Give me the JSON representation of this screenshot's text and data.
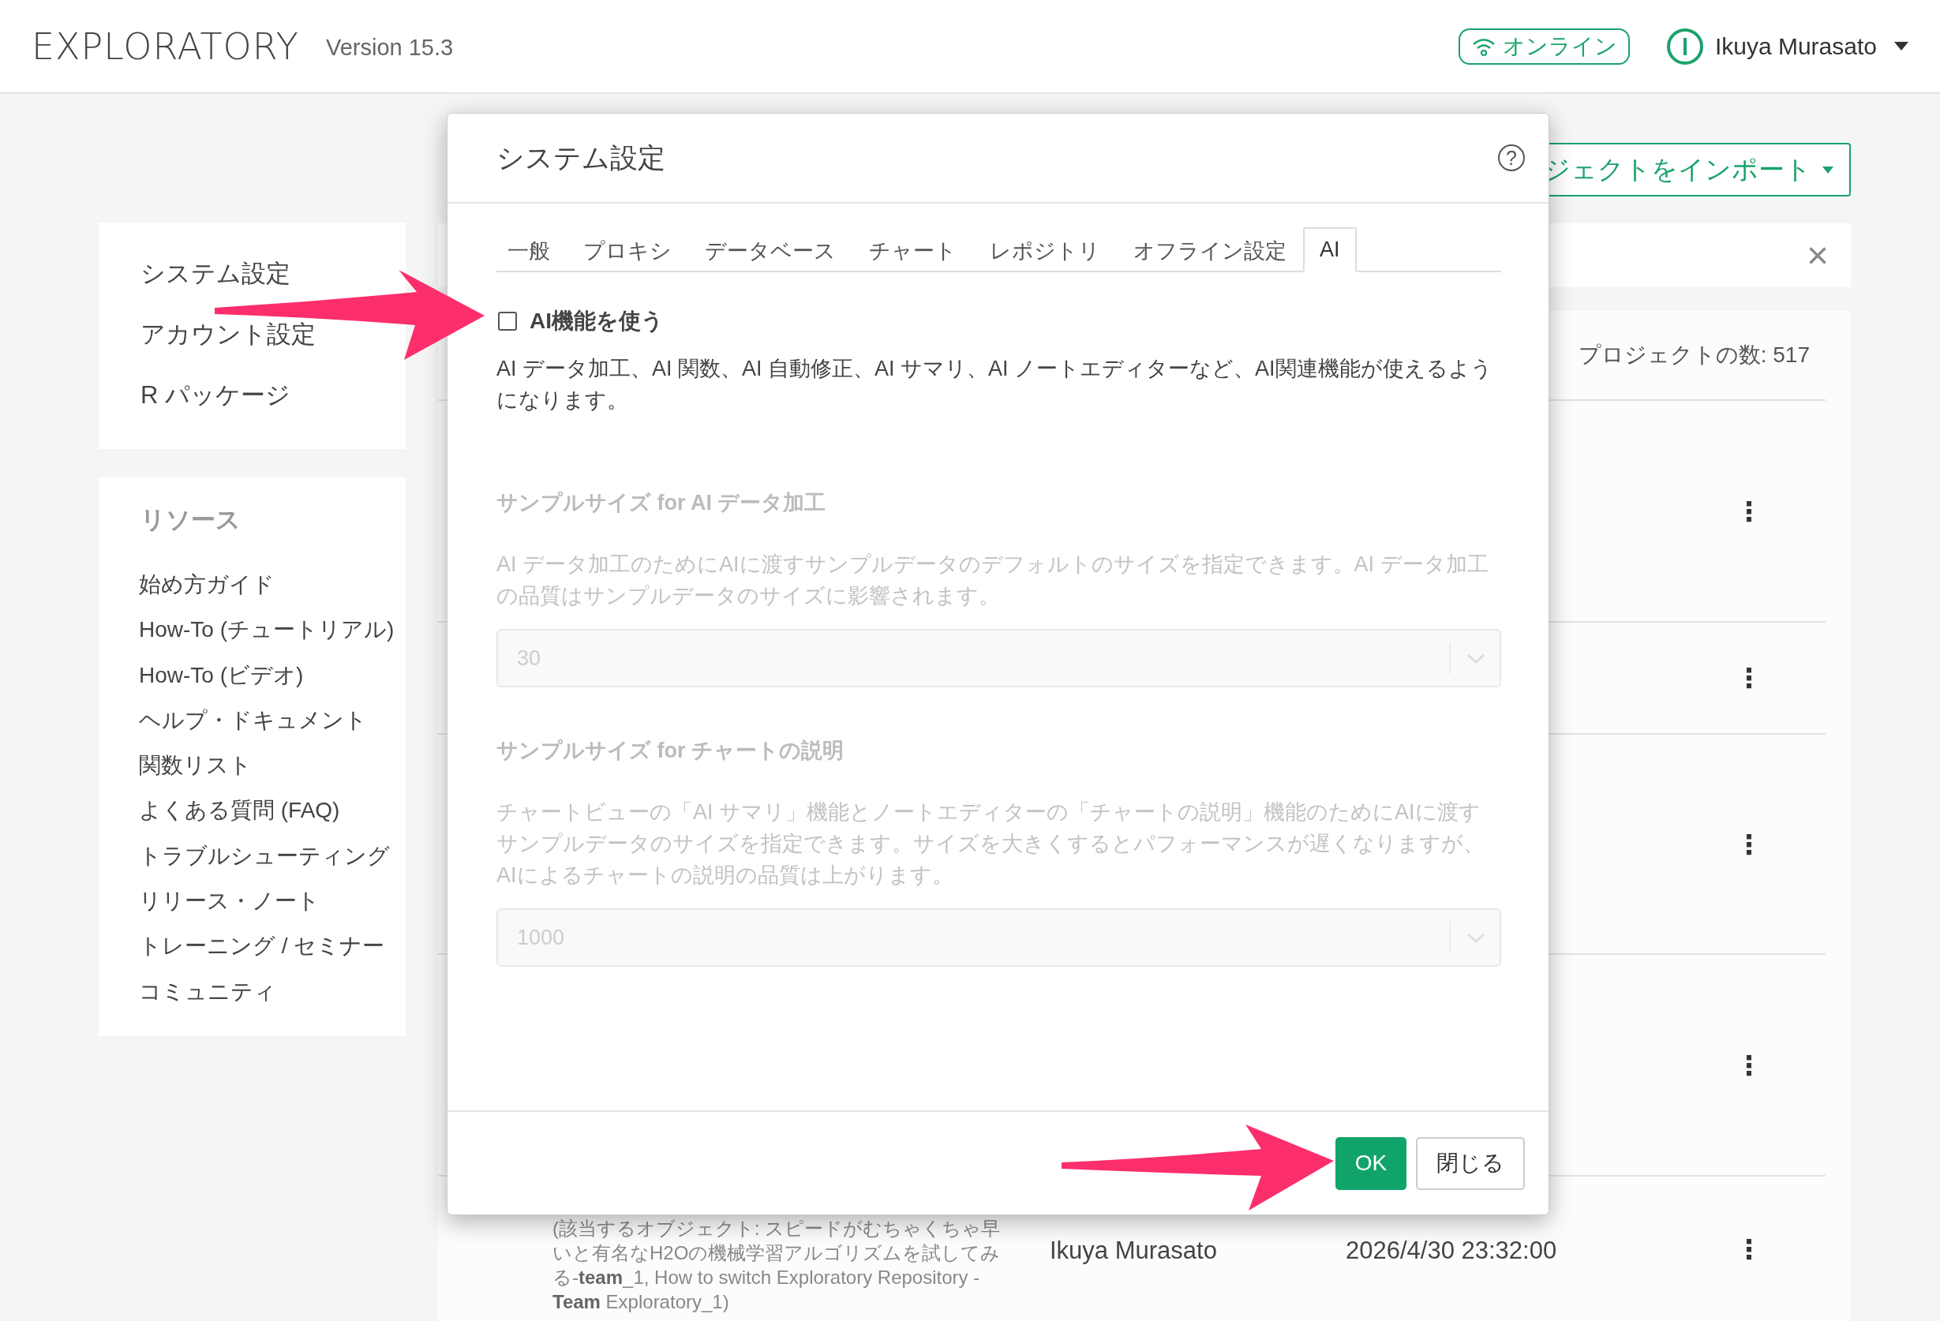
{
  "header": {
    "logo": "EXPLORATORY",
    "version": "Version 15.3",
    "status": "オンライン",
    "user": "Ikuya Murasato"
  },
  "sidebar": {
    "settings": [
      "システム設定",
      "アカウント設定",
      "R パッケージ"
    ],
    "resources_title": "リソース",
    "resources": [
      "始め方ガイド",
      "How-To (チュートリアル)",
      "How-To (ビデオ)",
      "ヘルプ・ドキュメント",
      "関数リスト",
      "よくある質問 (FAQ)",
      "トラブルシューティング",
      "リリース・ノート",
      "トレーニング / セミナー",
      "コミュニティ"
    ]
  },
  "main": {
    "import_button": "ジェクトをインポート",
    "close": "×",
    "project_count": "プロジェクトの数: 517",
    "rows": [
      {
        "menu": "⋮"
      },
      {
        "menu": "⋮"
      },
      {
        "menu": "⋮"
      },
      {
        "menu": "⋮"
      },
      {
        "description": "(該当するオブジェクト: スピードがむちゃくちゃ早いと有名なH2Oの機械学習アルゴリズムを試してみる-**team**_1, How to switch Exploratory Repository - **Team** Exploratory_1)",
        "owner": "Ikuya Murasato",
        "updated": "2026/4/30 23:32:00",
        "menu": "⋮"
      }
    ]
  },
  "dialog": {
    "title": "システム設定",
    "help": "?",
    "tabs": [
      {
        "label": "一般",
        "selected": false
      },
      {
        "label": "プロキシ",
        "selected": false
      },
      {
        "label": "データベース",
        "selected": false
      },
      {
        "label": "チャート",
        "selected": false
      },
      {
        "label": "レポジトリ",
        "selected": false
      },
      {
        "label": "オフライン設定",
        "selected": false
      },
      {
        "label": "AI",
        "selected": true
      }
    ],
    "enable_ai": {
      "label": "AI機能を使う",
      "checked": false
    },
    "description": "AI データ加工、AI 関数、AI 自動修正、AI サマリ、AI ノートエディターなど、AI関連機能が使えるようになります。",
    "settings": [
      {
        "title": "サンプルサイズ for AI データ加工",
        "description": "AI データ加工のためにAIに渡すサンプルデータのデフォルトのサイズを指定できます。AI データ加工の品質はサンプルデータのサイズに影響されます。",
        "value": "30",
        "disabled": true
      },
      {
        "title": "サンプルサイズ for チャートの説明",
        "description": "チャートビューの「AI サマリ」機能とノートエディターの「チャートの説明」機能のためにAIに渡すサンプルデータのサイズを指定できます。サイズを大きくするとパフォーマンスが遅くなりますが、AIによるチャートの説明の品質は上がります。",
        "value": "1000",
        "disabled": true
      }
    ],
    "buttons": [
      {
        "label": "OK",
        "kind": "primary"
      },
      {
        "label": "閉じる",
        "kind": "default"
      }
    ]
  }
}
